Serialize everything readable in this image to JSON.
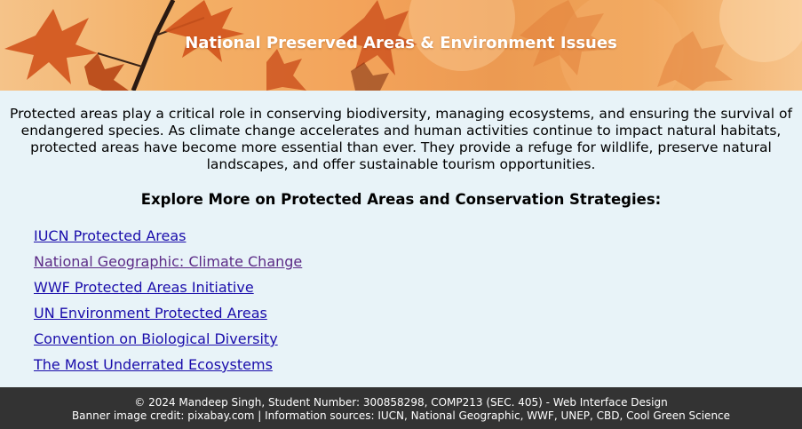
{
  "banner": {
    "title": "National Preserved Areas & Environment Issues",
    "image": "autumn-maple-leaves-banner"
  },
  "intro": {
    "text": "Protected areas play a critical role in conserving biodiversity, managing ecosystems, and ensuring the survival of endangered species. As climate change accelerates and human activities continue to impact natural habitats, protected areas have become more essential than ever. They provide a refuge for wildlife, preserve natural landscapes, and offer sustainable tourism opportunities."
  },
  "explore": {
    "heading": "Explore More on Protected Areas and Conservation Strategies:",
    "links": [
      {
        "label": "IUCN Protected Areas",
        "visited": false
      },
      {
        "label": "National Geographic: Climate Change",
        "visited": true
      },
      {
        "label": "WWF Protected Areas Initiative",
        "visited": false
      },
      {
        "label": "UN Environment Protected Areas",
        "visited": false
      },
      {
        "label": "Convention on Biological Diversity",
        "visited": false
      },
      {
        "label": "The Most Underrated Ecosystems",
        "visited": false
      }
    ]
  },
  "footer": {
    "line1": "© 2024 Mandeep Singh, Student Number: 300858298, COMP213 (SEC. 405) - Web Interface Design",
    "line2": "Banner image credit: pixabay.com | Information sources: IUCN, National Geographic, WWF, UNEP, CBD, Cool Green Science"
  },
  "colors": {
    "page_background": "#e8f3f8",
    "link": "#1a0dab",
    "link_visited": "#5b2a86",
    "footer_background": "#333333",
    "banner_text": "#ffffff"
  }
}
